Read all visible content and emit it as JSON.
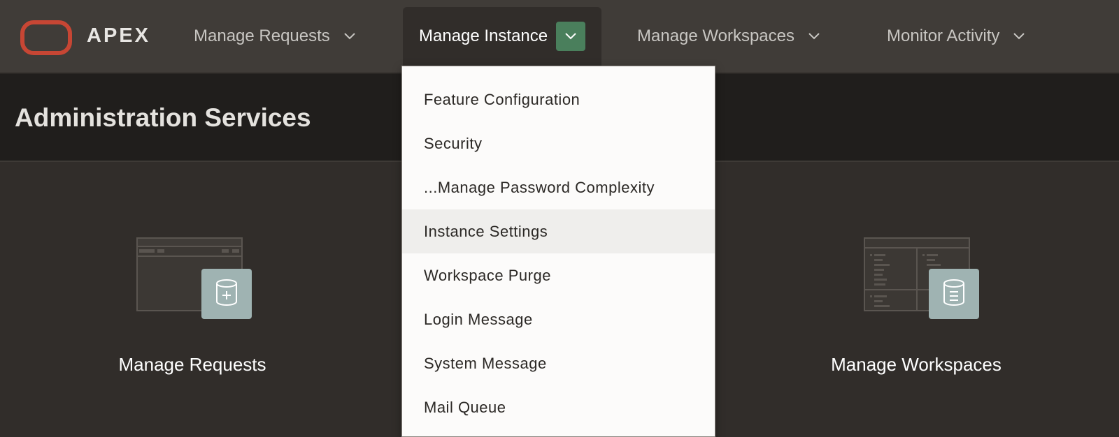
{
  "header": {
    "brand": "APEX",
    "nav": [
      {
        "label": "Manage Requests"
      },
      {
        "label": "Manage Instance"
      },
      {
        "label": "Manage Workspaces"
      },
      {
        "label": "Monitor Activity"
      }
    ]
  },
  "page": {
    "title": "Administration Services"
  },
  "cards": [
    {
      "label": "Manage Requests",
      "icon": "database-add-icon"
    },
    {
      "label": "Manage Workspaces",
      "icon": "database-list-icon"
    }
  ],
  "dropdown": {
    "items": [
      {
        "label": "Feature Configuration"
      },
      {
        "label": "Security"
      },
      {
        "label": "...Manage Password Complexity"
      },
      {
        "label": "Instance Settings"
      },
      {
        "label": "Workspace Purge"
      },
      {
        "label": "Login Message"
      },
      {
        "label": "System Message"
      },
      {
        "label": "Mail Queue"
      }
    ]
  },
  "colors": {
    "topbar": "#403c38",
    "brand_logo": "#c74634",
    "active_chevron": "#4a7f5c",
    "card_badge": "#9fb3b2"
  }
}
